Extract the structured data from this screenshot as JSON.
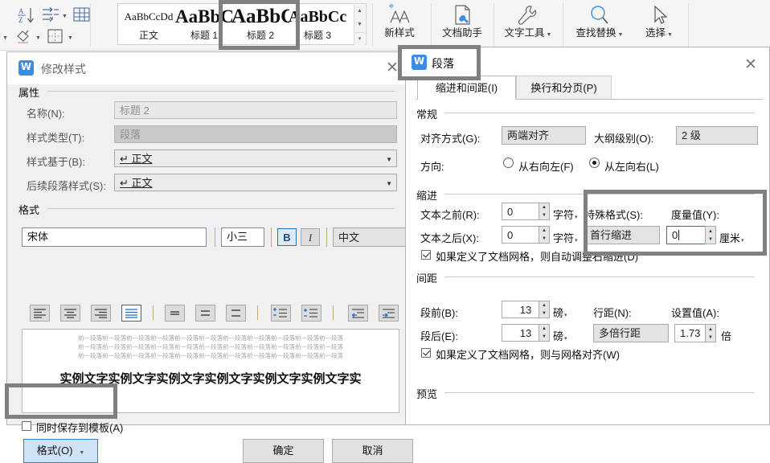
{
  "ribbon": {
    "icons": [
      {
        "name": "sort-az-icon"
      },
      {
        "name": "show-paragraph-marks-icon"
      },
      {
        "name": "insert-table-icon"
      },
      {
        "name": "shading-icon"
      },
      {
        "name": "borders-icon"
      }
    ],
    "gallery": {
      "items": [
        {
          "sample": "AaBbCcDd",
          "label": "正文",
          "size": 13
        },
        {
          "sample": "AaBbC",
          "label": "标题 1",
          "size": 23
        },
        {
          "sample": "AaBbC",
          "label": "标题 2",
          "size": 25
        },
        {
          "sample": "AaBbCc",
          "label": "标题 3",
          "size": 20
        }
      ],
      "selected_index": 2
    },
    "buttons": [
      {
        "label": "新样式",
        "icon": "new-style-icon",
        "caret": false
      },
      {
        "label": "文档助手",
        "icon": "doc-assistant-icon",
        "caret": false
      },
      {
        "label": "文字工具",
        "icon": "text-tools-icon",
        "caret": true
      },
      {
        "label": "查找替换",
        "icon": "find-replace-icon",
        "caret": true
      },
      {
        "label": "选择",
        "icon": "select-icon",
        "caret": true
      }
    ]
  },
  "modify_style_dialog": {
    "title": "修改样式",
    "close_label": "✕",
    "properties": {
      "group_label": "属性",
      "name_label": "名称(N):",
      "name_value": "标题 2",
      "type_label": "样式类型(T):",
      "type_value": "段落",
      "basedon_label": "样式基于(B):",
      "basedon_value": "↵ 正文",
      "nextstyle_label": "后续段落样式(S):",
      "nextstyle_value": "↵ 正文"
    },
    "format": {
      "group_label": "格式",
      "font_value": "宋体",
      "size_value": "小三",
      "bold_label": "B",
      "italic_label": "I",
      "lang_value": "中文",
      "align_buttons": [
        "align-left",
        "align-center",
        "align-right",
        "align-justify"
      ],
      "linespacing_buttons": [
        "line-spacing-1",
        "line-spacing-15",
        "line-spacing-2"
      ],
      "list_buttons": [
        "increase-spacing-before",
        "decrease-spacing-after"
      ],
      "indent_buttons": [
        "decrease-indent",
        "increase-indent"
      ],
      "active_align_index": 3
    },
    "preview": {
      "gray_line": "前一段落前一段落前一段落前一段落前一段落前一段落前一段落前一段落前一段落前一段落前一段落",
      "sample_text": "实例文字实例文字实例文字实例文字实例文字实例文字实"
    },
    "save_to_template_label": "同时保存到模板(A)",
    "save_to_template_checked": false,
    "format_button_label": "格式(O)",
    "ok_label": "确定",
    "cancel_label": "取消"
  },
  "paragraph_dialog": {
    "title": "段落",
    "close_label": "✕",
    "tabs": [
      {
        "label": "缩进和间距(I)",
        "active": true
      },
      {
        "label": "换行和分页(P)",
        "active": false
      }
    ],
    "general": {
      "group_label": "常规",
      "align_label": "对齐方式(G):",
      "align_value": "两端对齐",
      "outline_label": "大纲级别(O):",
      "outline_value": "2 级",
      "direction_label": "方向:",
      "rtl_label": "从右向左(F)",
      "ltr_label": "从左向右(L)",
      "direction_selected": "ltr"
    },
    "indent": {
      "group_label": "缩进",
      "before_label": "文本之前(R):",
      "before_value": "0",
      "before_unit": "字符",
      "after_label": "文本之后(X):",
      "after_value": "0",
      "after_unit": "字符",
      "special_label": "特殊格式(S):",
      "special_value": "首行缩进",
      "measure_label": "度量值(Y):",
      "measure_value": "0",
      "measure_unit": "厘米",
      "autoadjust_label": "如果定义了文档网格，则自动调整石缩进(D)",
      "autoadjust_checked": true
    },
    "spacing": {
      "group_label": "间距",
      "before_label": "段前(B):",
      "before_value": "13",
      "before_unit": "磅",
      "after_label": "段后(E):",
      "after_value": "13",
      "after_unit": "磅",
      "linespacing_label": "行距(N):",
      "linespacing_value": "多倍行距",
      "setvalue_label": "设置值(A):",
      "setvalue_value": "1.73",
      "setvalue_unit": "倍",
      "snap_label": "如果定义了文档网格，则与网格对齐(W)",
      "snap_checked": true
    },
    "preview_group_label": "预览"
  },
  "colors": {
    "highlight_box": "#808080",
    "accent_blue": "#2a6fbb",
    "logo_blue": "#3c8ce4",
    "dialog_bg": "#f0f0f0"
  }
}
